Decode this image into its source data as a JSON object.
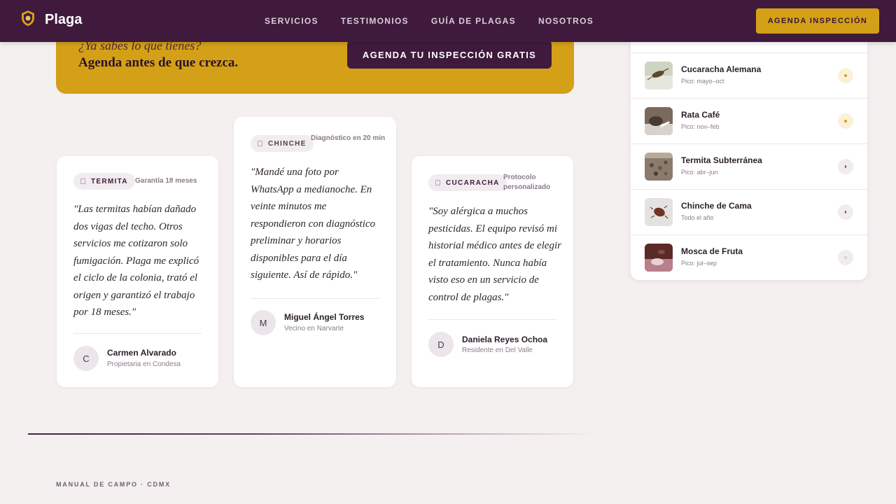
{
  "nav": {
    "brand": "Plaga",
    "links": [
      "SERVICIOS",
      "TESTIMONIOS",
      "GUÍA DE PLAGAS",
      "NOSOTROS"
    ],
    "cta": "AGENDA INSPECCIÓN"
  },
  "banner": {
    "question": "¿Ya sabes lo que tienes?",
    "headline": "Agenda antes de que crezca.",
    "button": "AGENDA TU INSPECCIÓN GRATIS"
  },
  "testimonials": [
    {
      "tag": "TERMITA",
      "side": "Garantía 18 meses",
      "quote": "\"Las termitas habían dañado dos vigas del techo. Otros servicios me cotizaron solo fumigación. Plaga me explicó el ciclo de la colonia, trató el origen y garantizó el trabajo por 18 meses.\"",
      "initial": "C",
      "name": "Carmen Alvarado",
      "role": "Propietaria en Condesa"
    },
    {
      "tag": "CHINCHE",
      "side": "Diagnóstico en 20 min",
      "quote": "\"Mandé una foto por WhatsApp a medianoche. En veinte minutos me respondieron con diagnóstico preliminar y horarios disponibles para el día siguiente. Así de rápido.\"",
      "initial": "M",
      "name": "Miguel Ángel Torres",
      "role": "Vecino en Narvarte"
    },
    {
      "tag": "CUCARACHA",
      "side": "Protocolo personalizado",
      "quote": "\"Soy alérgica a muchos pesticidas. El equipo revisó mi historial médico antes de elegir el tratamiento. Nunca había visto eso en un servicio de control de plagas.\"",
      "initial": "D",
      "name": "Daniela Reyes Ochoa",
      "role": "Residente en Del Valle"
    }
  ],
  "pests": [
    {
      "name": "Cucaracha Alemana",
      "peak": "Pico: mayo–oct",
      "level_color": "#d4a017",
      "level_bg": "#fbf1d9"
    },
    {
      "name": "Rata Café",
      "peak": "Pico: nov–feb",
      "level_color": "#d4a017",
      "level_bg": "#fbf1d9"
    },
    {
      "name": "Termita Subterránea",
      "peak": "Pico: abr–jun",
      "level_color": "#7a3a5c",
      "level_bg": "#f1ecef"
    },
    {
      "name": "Chinche de Cama",
      "peak": "Todo el año",
      "level_color": "#7a3a5c",
      "level_bg": "#f1ecef"
    },
    {
      "name": "Mosca de Fruta",
      "peak": "Pico: jul–sep",
      "level_color": "#ffffff",
      "level_bg": "#f1ecef"
    }
  ],
  "manual": {
    "eyebrow": "MANUAL DE CAMPO · CDMX"
  }
}
